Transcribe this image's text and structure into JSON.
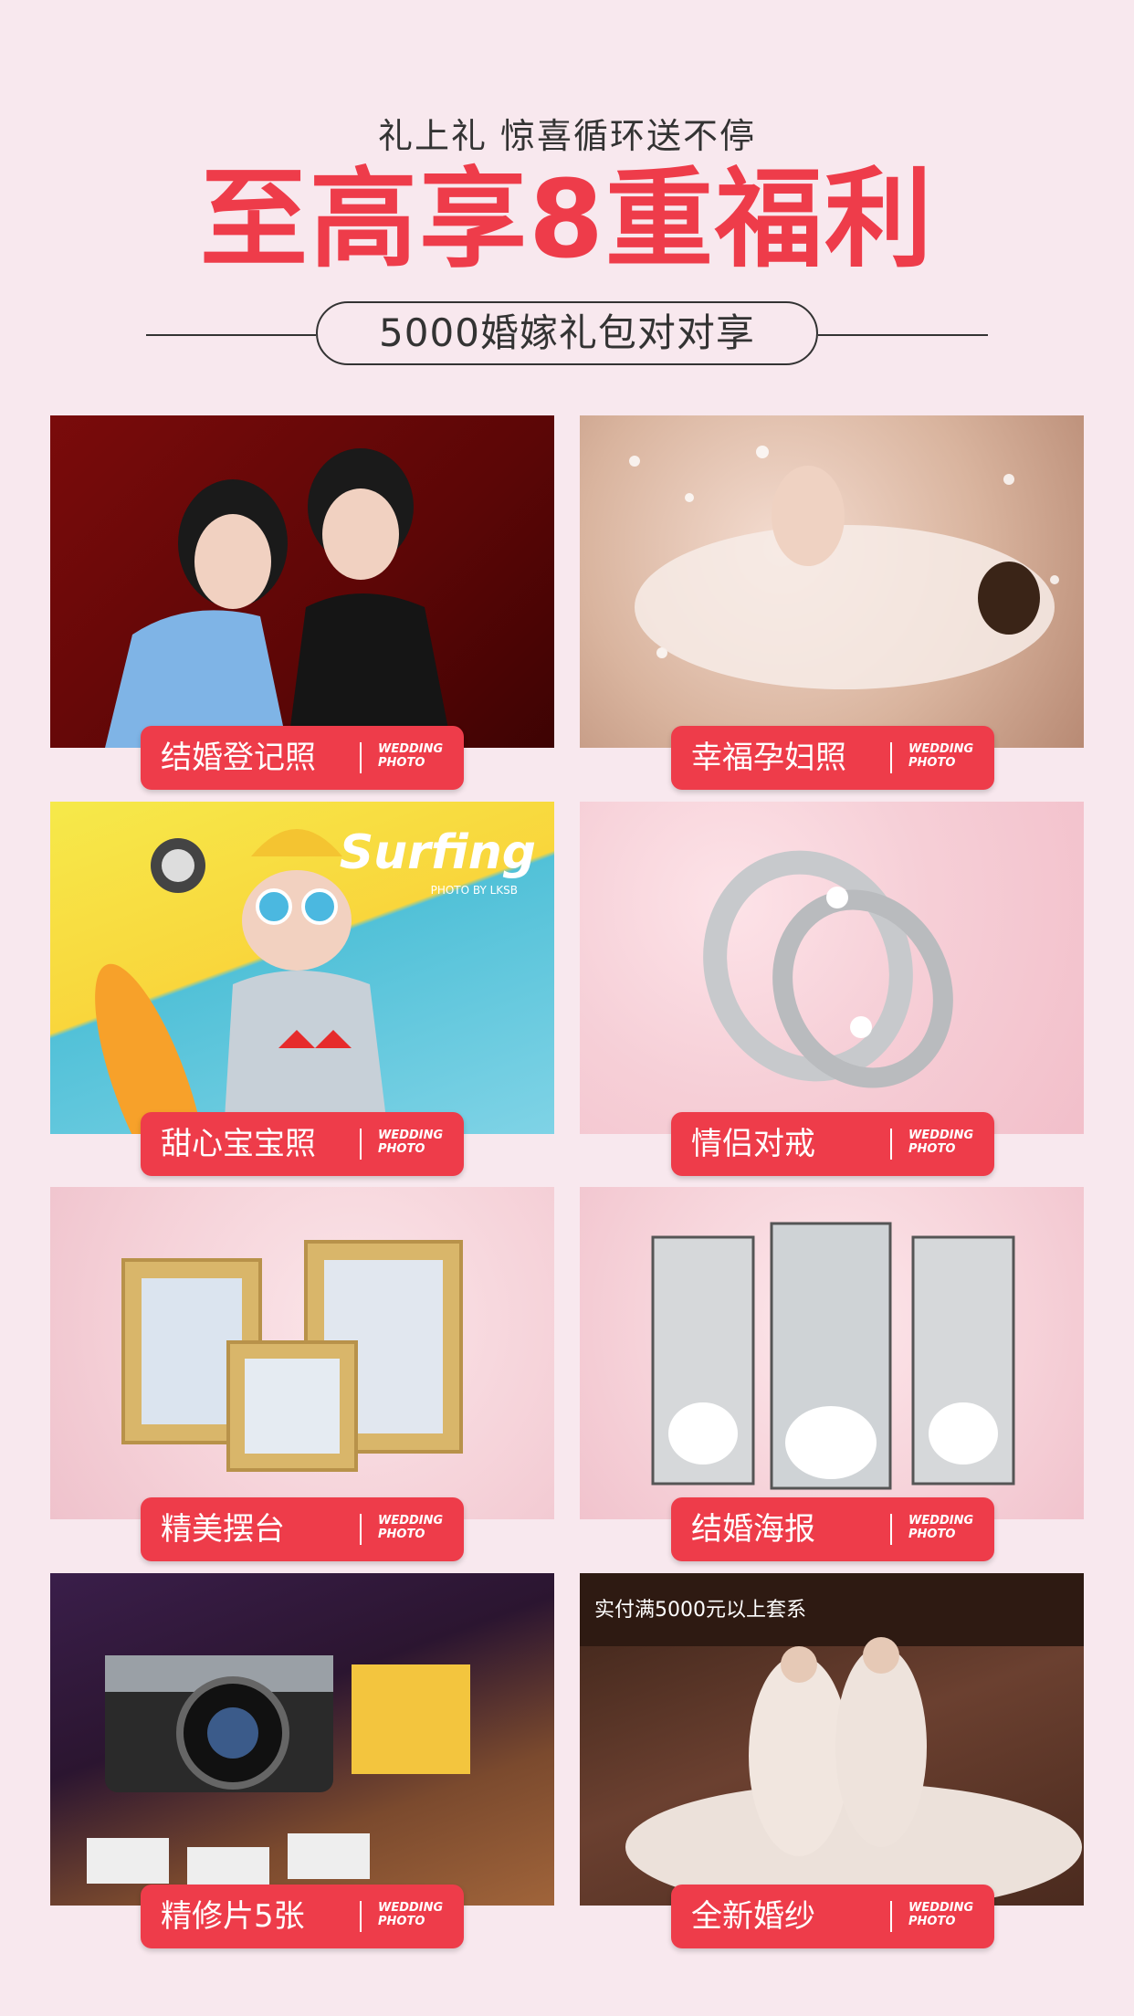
{
  "header": {
    "subtitle": "礼上礼 惊喜循环送不停",
    "headline": "至高享8重福利",
    "pill_text": "5000婚嫁礼包对对享"
  },
  "cards": [
    {
      "title": "结婚登记照",
      "tag_line1": "WEDDING",
      "tag_line2": "PHOTO",
      "image": "couple-registration-photo"
    },
    {
      "title": "幸福孕妇照",
      "tag_line1": "WEDDING",
      "tag_line2": "PHOTO",
      "image": "maternity-photo"
    },
    {
      "title": "甜心宝宝照",
      "tag_line1": "WEDDING",
      "tag_line2": "PHOTO",
      "image": "baby-photo",
      "photo_text": "Surfing",
      "photo_subtext": "PHOTO BY LKSB"
    },
    {
      "title": "情侣对戒",
      "tag_line1": "WEDDING",
      "tag_line2": "PHOTO",
      "image": "couple-rings"
    },
    {
      "title": "精美摆台",
      "tag_line1": "WEDDING",
      "tag_line2": "PHOTO",
      "image": "photo-frames"
    },
    {
      "title": "结婚海报",
      "tag_line1": "WEDDING",
      "tag_line2": "PHOTO",
      "image": "wedding-posters"
    },
    {
      "title": "精修片5张",
      "tag_line1": "WEDDING",
      "tag_line2": "PHOTO",
      "image": "camera-and-film"
    },
    {
      "title": "全新婚纱",
      "tag_line1": "WEDDING",
      "tag_line2": "PHOTO",
      "image": "wedding-dresses",
      "photo_text": "实付满5000元以上套系"
    }
  ],
  "colors": {
    "accent": "#ee3c4a",
    "background": "#f8e8ee",
    "text": "#333333"
  }
}
